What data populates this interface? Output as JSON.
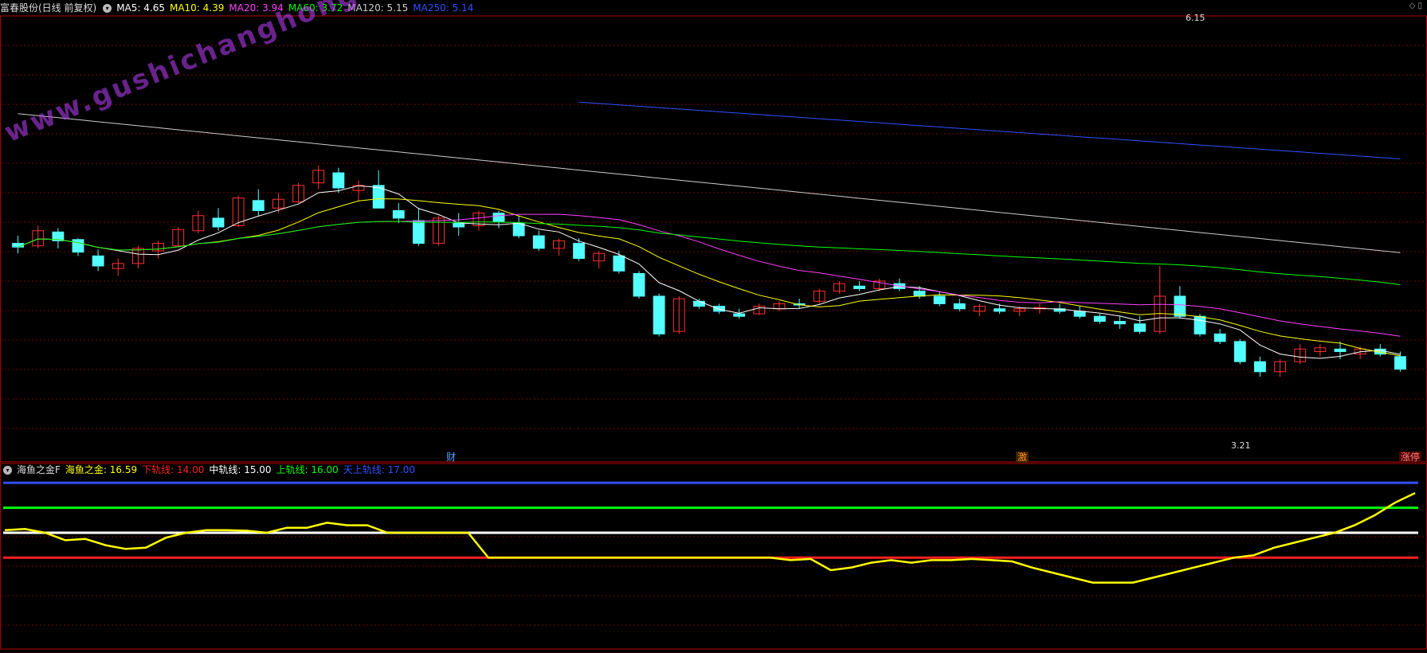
{
  "main_header": {
    "stock_name": "富春股份(日线 前复权)",
    "mas": [
      {
        "label": "MA5: 4.65",
        "color": "#ffffff"
      },
      {
        "label": "MA10: 4.39",
        "color": "#ffff00"
      },
      {
        "label": "MA20: 3.94",
        "color": "#ff40ff"
      },
      {
        "label": "MA60: 3.72",
        "color": "#00ff00"
      },
      {
        "label": "MA120: 5.15",
        "color": "#cccccc"
      },
      {
        "label": "MA250: 5.14",
        "color": "#3050ff"
      }
    ]
  },
  "watermark": "www.gushichanghong.com",
  "price_labels": {
    "high": "6.15",
    "low": "3.21"
  },
  "markers": {
    "m1": "财",
    "m2": "激",
    "m3": "涨停"
  },
  "indicator_header": {
    "name": "海鱼之金F",
    "items": [
      {
        "label": "海鱼之金: 16.59",
        "color": "#ffff00"
      },
      {
        "label": "下轨线: 14.00",
        "color": "#ff2020"
      },
      {
        "label": "中轨线: 15.00",
        "color": "#ffffff"
      },
      {
        "label": "上轨线: 16.00",
        "color": "#00ff00"
      },
      {
        "label": "天上轨线: 17.00",
        "color": "#3050ff"
      }
    ]
  },
  "colors": {
    "up": "#ff3030",
    "down": "#54ffff",
    "grid": "#7a0000",
    "border": "#b00000"
  },
  "chart_data": {
    "type": "candlestick",
    "y_range_main": [
      3.21,
      6.15
    ],
    "candles": [
      [
        4.82,
        4.88,
        4.74,
        4.79
      ],
      [
        4.8,
        4.96,
        4.78,
        4.92
      ],
      [
        4.91,
        4.94,
        4.78,
        4.84
      ],
      [
        4.85,
        4.86,
        4.72,
        4.75
      ],
      [
        4.72,
        4.77,
        4.6,
        4.64
      ],
      [
        4.62,
        4.7,
        4.56,
        4.66
      ],
      [
        4.66,
        4.8,
        4.62,
        4.78
      ],
      [
        4.76,
        4.84,
        4.7,
        4.82
      ],
      [
        4.8,
        4.95,
        4.79,
        4.93
      ],
      [
        4.92,
        5.08,
        4.9,
        5.04
      ],
      [
        5.02,
        5.1,
        4.92,
        4.95
      ],
      [
        4.96,
        5.2,
        4.95,
        5.18
      ],
      [
        5.16,
        5.25,
        5.04,
        5.08
      ],
      [
        5.1,
        5.22,
        5.06,
        5.17
      ],
      [
        5.15,
        5.3,
        5.14,
        5.28
      ],
      [
        5.3,
        5.44,
        5.25,
        5.4
      ],
      [
        5.38,
        5.42,
        5.22,
        5.26
      ],
      [
        5.24,
        5.32,
        5.16,
        5.28
      ],
      [
        5.28,
        5.4,
        5.22,
        5.1
      ],
      [
        5.08,
        5.14,
        4.98,
        5.02
      ],
      [
        5.0,
        5.1,
        4.8,
        4.82
      ],
      [
        4.82,
        5.04,
        4.8,
        5.02
      ],
      [
        4.98,
        5.06,
        4.88,
        4.95
      ],
      [
        4.96,
        5.08,
        4.92,
        5.06
      ],
      [
        5.06,
        5.08,
        4.94,
        4.99
      ],
      [
        4.98,
        5.04,
        4.86,
        4.88
      ],
      [
        4.88,
        4.92,
        4.76,
        4.78
      ],
      [
        4.78,
        4.86,
        4.72,
        4.84
      ],
      [
        4.82,
        4.86,
        4.68,
        4.7
      ],
      [
        4.68,
        4.76,
        4.62,
        4.74
      ],
      [
        4.72,
        4.76,
        4.58,
        4.6
      ],
      [
        4.58,
        4.6,
        4.38,
        4.4
      ],
      [
        4.4,
        4.42,
        4.08,
        4.1
      ],
      [
        4.12,
        4.4,
        4.1,
        4.38
      ],
      [
        4.36,
        4.38,
        4.3,
        4.32
      ],
      [
        4.32,
        4.34,
        4.26,
        4.28
      ],
      [
        4.26,
        4.3,
        4.22,
        4.24
      ],
      [
        4.26,
        4.34,
        4.25,
        4.32
      ],
      [
        4.3,
        4.36,
        4.28,
        4.34
      ],
      [
        4.34,
        4.38,
        4.3,
        4.33
      ],
      [
        4.36,
        4.46,
        4.34,
        4.44
      ],
      [
        4.44,
        4.52,
        4.42,
        4.5
      ],
      [
        4.48,
        4.52,
        4.44,
        4.46
      ],
      [
        4.46,
        4.54,
        4.44,
        4.52
      ],
      [
        4.5,
        4.54,
        4.44,
        4.46
      ],
      [
        4.44,
        4.48,
        4.38,
        4.4
      ],
      [
        4.4,
        4.44,
        4.32,
        4.34
      ],
      [
        4.34,
        4.38,
        4.28,
        4.3
      ],
      [
        4.28,
        4.34,
        4.24,
        4.32
      ],
      [
        4.3,
        4.34,
        4.26,
        4.28
      ],
      [
        4.28,
        4.32,
        4.24,
        4.3
      ],
      [
        4.3,
        4.34,
        4.26,
        4.31
      ],
      [
        4.3,
        4.34,
        4.26,
        4.28
      ],
      [
        4.28,
        4.32,
        4.22,
        4.24
      ],
      [
        4.24,
        4.26,
        4.18,
        4.2
      ],
      [
        4.2,
        4.24,
        4.14,
        4.18
      ],
      [
        4.18,
        4.24,
        4.1,
        4.12
      ],
      [
        4.12,
        4.64,
        4.1,
        4.4
      ],
      [
        4.4,
        4.48,
        4.22,
        4.24
      ],
      [
        4.24,
        4.26,
        4.08,
        4.1
      ],
      [
        4.1,
        4.14,
        4.02,
        4.04
      ],
      [
        4.04,
        4.06,
        3.86,
        3.88
      ],
      [
        3.88,
        3.92,
        3.76,
        3.8
      ],
      [
        3.8,
        3.9,
        3.76,
        3.88
      ],
      [
        3.88,
        4.02,
        3.86,
        3.98
      ],
      [
        3.96,
        4.02,
        3.92,
        3.99
      ],
      [
        3.98,
        4.04,
        3.9,
        3.96
      ],
      [
        3.94,
        4.0,
        3.9,
        3.98
      ],
      [
        3.98,
        4.02,
        3.92,
        3.94
      ],
      [
        3.92,
        3.96,
        3.8,
        3.82
      ]
    ]
  },
  "indicator_data": {
    "y_range": [
      10.5,
      17.2
    ],
    "values": [
      15.1,
      15.15,
      15.0,
      14.7,
      14.75,
      14.5,
      14.35,
      14.4,
      14.8,
      15.0,
      15.1,
      15.1,
      15.08,
      15.0,
      15.2,
      15.2,
      15.4,
      15.3,
      15.3,
      15.0,
      15.0,
      15.0,
      15.0,
      15.0,
      14.0,
      14.0,
      14.0,
      14.0,
      14.0,
      14.0,
      14.0,
      14.0,
      14.0,
      14.0,
      14.0,
      14.0,
      14.0,
      14.0,
      14.0,
      13.9,
      13.95,
      13.5,
      13.6,
      13.8,
      13.9,
      13.8,
      13.9,
      13.9,
      13.95,
      13.9,
      13.85,
      13.6,
      13.4,
      13.2,
      13.0,
      13.0,
      13.0,
      13.2,
      13.4,
      13.6,
      13.8,
      14.0,
      14.1,
      14.4,
      14.6,
      14.8,
      15.0,
      15.3,
      15.7,
      16.2,
      16.59
    ]
  }
}
